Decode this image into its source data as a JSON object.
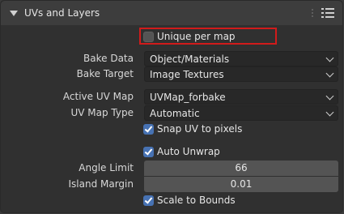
{
  "panel": {
    "title": "UVs and Layers"
  },
  "unique_per_map": {
    "label": "Unique per map",
    "checked": false
  },
  "bake_data": {
    "label": "Bake Data",
    "value": "Object/Materials"
  },
  "bake_target": {
    "label": "Bake Target",
    "value": "Image Textures"
  },
  "active_uv_map": {
    "label": "Active UV Map",
    "value": "UVMap_forbake"
  },
  "uv_map_type": {
    "label": "UV Map Type",
    "value": "Automatic"
  },
  "snap_uv": {
    "label": "Snap UV to pixels",
    "checked": true
  },
  "auto_unwrap": {
    "label": "Auto Unwrap",
    "checked": true
  },
  "angle_limit": {
    "label": "Angle Limit",
    "value": "66"
  },
  "island_margin": {
    "label": "Island Margin",
    "value": "0.01"
  },
  "scale_to_bounds": {
    "label": "Scale to Bounds",
    "checked": true
  },
  "colors": {
    "accent": "#4772b3",
    "highlight": "#d11b1b"
  }
}
